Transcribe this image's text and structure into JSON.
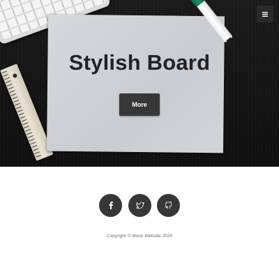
{
  "hero": {
    "title": "Stylish Board",
    "more_label": "More"
  },
  "header": {
    "menu_icon": "hamburger-icon"
  },
  "social": {
    "items": [
      {
        "name": "facebook",
        "icon": "facebook-icon"
      },
      {
        "name": "twitter",
        "icon": "twitter-icon"
      },
      {
        "name": "github",
        "icon": "github-icon"
      }
    ]
  },
  "footer": {
    "copyright": "Copyright © Moon Website 2020"
  },
  "colors": {
    "button_bg": "#373737",
    "title_text": "#1f2227",
    "paper": "#cfd2d6",
    "desk": "#141414",
    "marker_cap": "#1f8a6b"
  }
}
